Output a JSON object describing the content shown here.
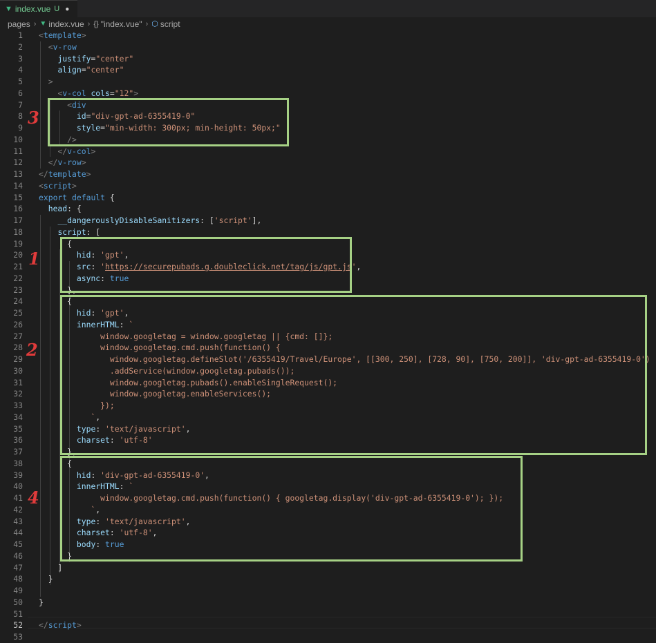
{
  "tab": {
    "name": "index.vue",
    "status": "U",
    "dirty_dot": "●"
  },
  "breadcrumb": {
    "folder": "pages",
    "file": "index.vue",
    "component": "\"index.vue\"",
    "section": "script"
  },
  "annotations": [
    "1",
    "2",
    "3",
    "4"
  ],
  "colors": {
    "highlight_box": "#a6d185",
    "annotation_number": "#e03b3b",
    "editor_bg": "#1e1e1e"
  },
  "active_line": 52,
  "lines": [
    {
      "n": 1,
      "t": [
        [
          "tp",
          "<"
        ],
        [
          "tg",
          "template"
        ],
        [
          "tp",
          ">"
        ]
      ]
    },
    {
      "n": 2,
      "t": [
        [
          "pl",
          "  "
        ],
        [
          "tp",
          "<"
        ],
        [
          "tg",
          "v-row"
        ]
      ]
    },
    {
      "n": 3,
      "t": [
        [
          "pl",
          "    "
        ],
        [
          "at",
          "justify"
        ],
        [
          "pl",
          "="
        ],
        [
          "st",
          "\"center\""
        ]
      ]
    },
    {
      "n": 4,
      "t": [
        [
          "pl",
          "    "
        ],
        [
          "at",
          "align"
        ],
        [
          "pl",
          "="
        ],
        [
          "st",
          "\"center\""
        ]
      ]
    },
    {
      "n": 5,
      "t": [
        [
          "pl",
          "  "
        ],
        [
          "tp",
          ">"
        ]
      ]
    },
    {
      "n": 6,
      "t": [
        [
          "pl",
          "    "
        ],
        [
          "tp",
          "<"
        ],
        [
          "tg",
          "v-col"
        ],
        [
          "pl",
          " "
        ],
        [
          "at",
          "cols"
        ],
        [
          "pl",
          "="
        ],
        [
          "st",
          "\"12\""
        ],
        [
          "tp",
          ">"
        ]
      ]
    },
    {
      "n": 7,
      "t": [
        [
          "pl",
          "      "
        ],
        [
          "tp",
          "<"
        ],
        [
          "tg",
          "div"
        ]
      ]
    },
    {
      "n": 8,
      "t": [
        [
          "pl",
          "        "
        ],
        [
          "at",
          "id"
        ],
        [
          "pl",
          "="
        ],
        [
          "st",
          "\"div-gpt-ad-6355419-0\""
        ]
      ]
    },
    {
      "n": 9,
      "t": [
        [
          "pl",
          "        "
        ],
        [
          "at",
          "style"
        ],
        [
          "pl",
          "="
        ],
        [
          "st",
          "\"min-width: 300px; min-height: 50px;\""
        ]
      ]
    },
    {
      "n": 10,
      "t": [
        [
          "pl",
          "      "
        ],
        [
          "tp",
          "/>"
        ]
      ]
    },
    {
      "n": 11,
      "t": [
        [
          "pl",
          "    "
        ],
        [
          "tp",
          "</"
        ],
        [
          "tg",
          "v-col"
        ],
        [
          "tp",
          ">"
        ]
      ]
    },
    {
      "n": 12,
      "t": [
        [
          "pl",
          "  "
        ],
        [
          "tp",
          "</"
        ],
        [
          "tg",
          "v-row"
        ],
        [
          "tp",
          ">"
        ]
      ]
    },
    {
      "n": 13,
      "t": [
        [
          "tp",
          "</"
        ],
        [
          "tg",
          "template"
        ],
        [
          "tp",
          ">"
        ]
      ]
    },
    {
      "n": 14,
      "t": [
        [
          "tp",
          "<"
        ],
        [
          "tg",
          "script"
        ],
        [
          "tp",
          ">"
        ]
      ]
    },
    {
      "n": 15,
      "t": [
        [
          "kw",
          "export"
        ],
        [
          "pl",
          " "
        ],
        [
          "kw",
          "default"
        ],
        [
          "pl",
          " {"
        ]
      ]
    },
    {
      "n": 16,
      "t": [
        [
          "pl",
          "  "
        ],
        [
          "pr",
          "head"
        ],
        [
          "pl",
          ": {"
        ]
      ]
    },
    {
      "n": 17,
      "t": [
        [
          "pl",
          "    "
        ],
        [
          "pr",
          "__dangerouslyDisableSanitizers"
        ],
        [
          "pl",
          ": ["
        ],
        [
          "st",
          "'script'"
        ],
        [
          "pl",
          "],"
        ]
      ]
    },
    {
      "n": 18,
      "t": [
        [
          "pl",
          "    "
        ],
        [
          "pr",
          "script"
        ],
        [
          "pl",
          ": ["
        ]
      ]
    },
    {
      "n": 19,
      "t": [
        [
          "pl",
          "      {"
        ]
      ]
    },
    {
      "n": 20,
      "t": [
        [
          "pl",
          "        "
        ],
        [
          "pr",
          "hid"
        ],
        [
          "pl",
          ": "
        ],
        [
          "st",
          "'gpt'"
        ],
        [
          "pl",
          ","
        ]
      ]
    },
    {
      "n": 21,
      "t": [
        [
          "pl",
          "        "
        ],
        [
          "pr",
          "src"
        ],
        [
          "pl",
          ": "
        ],
        [
          "st",
          "'"
        ],
        [
          "ln-u",
          "https://securepubads.g.doubleclick.net/tag/js/gpt.js"
        ],
        [
          "st",
          "'"
        ],
        [
          "pl",
          ","
        ]
      ]
    },
    {
      "n": 22,
      "t": [
        [
          "pl",
          "        "
        ],
        [
          "pr",
          "async"
        ],
        [
          "pl",
          ": "
        ],
        [
          "kw",
          "true"
        ]
      ]
    },
    {
      "n": 23,
      "t": [
        [
          "pl",
          "      },"
        ]
      ]
    },
    {
      "n": 24,
      "t": [
        [
          "pl",
          "      {"
        ]
      ]
    },
    {
      "n": 25,
      "t": [
        [
          "pl",
          "        "
        ],
        [
          "pr",
          "hid"
        ],
        [
          "pl",
          ": "
        ],
        [
          "st",
          "'gpt'"
        ],
        [
          "pl",
          ","
        ]
      ]
    },
    {
      "n": 26,
      "t": [
        [
          "pl",
          "        "
        ],
        [
          "pr",
          "innerHTML"
        ],
        [
          "pl",
          ": "
        ],
        [
          "st",
          "`"
        ]
      ]
    },
    {
      "n": 27,
      "t": [
        [
          "st",
          "             window.googletag = window.googletag || {cmd: []};"
        ]
      ]
    },
    {
      "n": 28,
      "t": [
        [
          "st",
          "             window.googletag.cmd.push(function() {"
        ]
      ]
    },
    {
      "n": 29,
      "t": [
        [
          "st",
          "               window.googletag.defineSlot('/6355419/Travel/Europe', [[300, 250], [728, 90], [750, 200]], 'div-gpt-ad-6355419-0')"
        ]
      ]
    },
    {
      "n": 30,
      "t": [
        [
          "st",
          "               .addService(window.googletag.pubads());"
        ]
      ]
    },
    {
      "n": 31,
      "t": [
        [
          "st",
          "               window.googletag.pubads().enableSingleRequest();"
        ]
      ]
    },
    {
      "n": 32,
      "t": [
        [
          "st",
          "               window.googletag.enableServices();"
        ]
      ]
    },
    {
      "n": 33,
      "t": [
        [
          "st",
          "             });"
        ]
      ]
    },
    {
      "n": 34,
      "t": [
        [
          "st",
          "           `"
        ],
        [
          "pl",
          ","
        ]
      ]
    },
    {
      "n": 35,
      "t": [
        [
          "pl",
          "        "
        ],
        [
          "pr",
          "type"
        ],
        [
          "pl",
          ": "
        ],
        [
          "st",
          "'text/javascript'"
        ],
        [
          "pl",
          ","
        ]
      ]
    },
    {
      "n": 36,
      "t": [
        [
          "pl",
          "        "
        ],
        [
          "pr",
          "charset"
        ],
        [
          "pl",
          ": "
        ],
        [
          "st",
          "'utf-8'"
        ]
      ]
    },
    {
      "n": 37,
      "t": [
        [
          "pl",
          "      },"
        ]
      ]
    },
    {
      "n": 38,
      "t": [
        [
          "pl",
          "      {"
        ]
      ]
    },
    {
      "n": 39,
      "t": [
        [
          "pl",
          "        "
        ],
        [
          "pr",
          "hid"
        ],
        [
          "pl",
          ": "
        ],
        [
          "st",
          "'div-gpt-ad-6355419-0'"
        ],
        [
          "pl",
          ","
        ]
      ]
    },
    {
      "n": 40,
      "t": [
        [
          "pl",
          "        "
        ],
        [
          "pr",
          "innerHTML"
        ],
        [
          "pl",
          ": "
        ],
        [
          "st",
          "`"
        ]
      ]
    },
    {
      "n": 41,
      "t": [
        [
          "st",
          "             window.googletag.cmd.push(function() { googletag.display('div-gpt-ad-6355419-0'); });"
        ]
      ]
    },
    {
      "n": 42,
      "t": [
        [
          "st",
          "           `"
        ],
        [
          "pl",
          ","
        ]
      ]
    },
    {
      "n": 43,
      "t": [
        [
          "pl",
          "        "
        ],
        [
          "pr",
          "type"
        ],
        [
          "pl",
          ": "
        ],
        [
          "st",
          "'text/javascript'"
        ],
        [
          "pl",
          ","
        ]
      ]
    },
    {
      "n": 44,
      "t": [
        [
          "pl",
          "        "
        ],
        [
          "pr",
          "charset"
        ],
        [
          "pl",
          ": "
        ],
        [
          "st",
          "'utf-8'"
        ],
        [
          "pl",
          ","
        ]
      ]
    },
    {
      "n": 45,
      "t": [
        [
          "pl",
          "        "
        ],
        [
          "pr",
          "body"
        ],
        [
          "pl",
          ": "
        ],
        [
          "kw",
          "true"
        ]
      ]
    },
    {
      "n": 46,
      "t": [
        [
          "pl",
          "      }"
        ]
      ]
    },
    {
      "n": 47,
      "t": [
        [
          "pl",
          "    ]"
        ]
      ]
    },
    {
      "n": 48,
      "t": [
        [
          "pl",
          "  }"
        ]
      ]
    },
    {
      "n": 49,
      "t": [
        [
          "pl",
          ""
        ]
      ]
    },
    {
      "n": 50,
      "t": [
        [
          "pl",
          "}"
        ]
      ]
    },
    {
      "n": 51,
      "t": [
        [
          "pl",
          ""
        ]
      ]
    },
    {
      "n": 52,
      "t": [
        [
          "tp",
          "</"
        ],
        [
          "tg",
          "script"
        ],
        [
          "tp",
          ">"
        ]
      ]
    },
    {
      "n": 53,
      "t": [
        [
          "pl",
          ""
        ]
      ]
    }
  ]
}
